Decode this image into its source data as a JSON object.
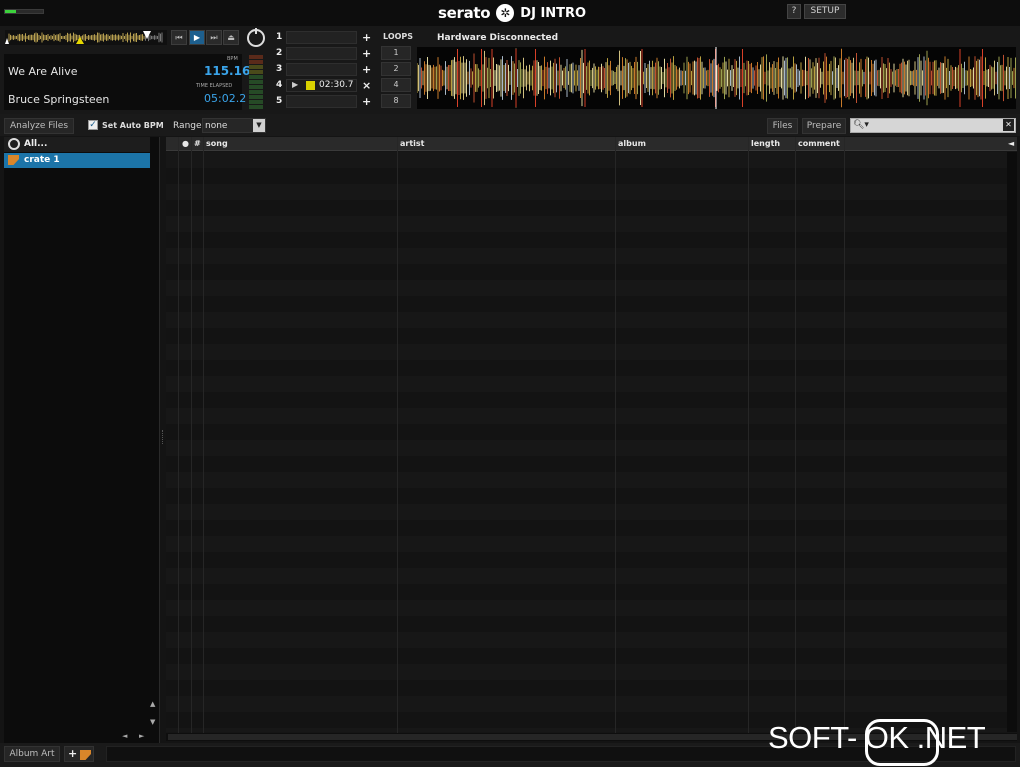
{
  "app": {
    "brand": "serato",
    "product": "DJ INTRO",
    "help": "?",
    "setup": "SETUP"
  },
  "deck": {
    "song": "We Are Alive",
    "artist": "Bruce Springsteen",
    "bpm_label": "BPM",
    "bpm": "115.16",
    "time_label": "TIME ELAPSED",
    "time": "05:02.2",
    "level": 0.3
  },
  "cues": [
    {
      "n": "1",
      "action": "+"
    },
    {
      "n": "2",
      "action": "+"
    },
    {
      "n": "3",
      "action": "+"
    },
    {
      "n": "4",
      "action": "×",
      "time": "02:30.7",
      "color": "#d9d100"
    },
    {
      "n": "5",
      "action": "+"
    }
  ],
  "loops": {
    "label": "LOOPS",
    "values": [
      "1",
      "2",
      "4",
      "8"
    ]
  },
  "waveform": {
    "status": "Hardware Disconnected"
  },
  "toolbar": {
    "analyze": "Analyze Files",
    "auto_bpm": "Set Auto BPM",
    "auto_bpm_checked": true,
    "range_label": "Range",
    "range_value": "none",
    "files": "Files",
    "prepare": "Prepare",
    "search_icon": "search-icon"
  },
  "crates": [
    {
      "label": "All...",
      "selected": false
    },
    {
      "label": "crate 1",
      "selected": true
    }
  ],
  "columns": [
    "●",
    "#",
    "song",
    "artist",
    "album",
    "length",
    "comment"
  ],
  "bottom": {
    "album_art": "Album Art",
    "add": "+"
  },
  "watermark": {
    "left": "SOFT-",
    "ring": "OK",
    "right": ".NET"
  },
  "colors": {
    "accent": "#3aa4ea",
    "selection": "#1c74a8",
    "cue": "#d9d100"
  }
}
